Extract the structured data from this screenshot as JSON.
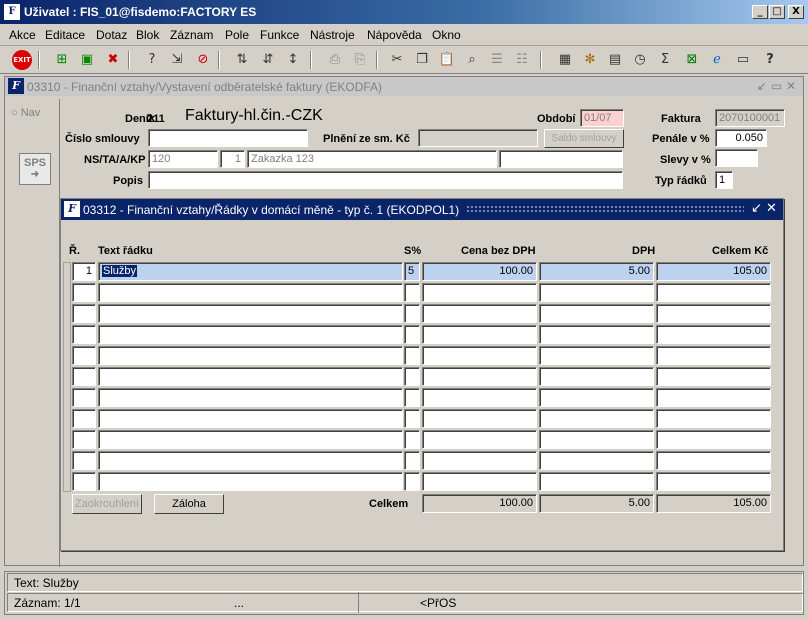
{
  "window": {
    "title": "Uživatel : FIS_01@fisdemo:FACTORY ES",
    "app_icon": "F",
    "minimize": "_",
    "maximize": "□",
    "close": "X"
  },
  "menu": [
    "Akce",
    "Editace",
    "Dotaz",
    "Blok",
    "Záznam",
    "Pole",
    "Funkce",
    "Nástroje",
    "Nápověda",
    "Okno"
  ],
  "toolbar": {
    "exit": "EXIT"
  },
  "form1": {
    "title": "03310 - Finanční vztahy/Vystavení odběratelské faktury (EKODFA)",
    "nav": "Nav",
    "sps": "SPS",
    "labels": {
      "denik": "Deník",
      "denik_val": "211",
      "denik_name": "Faktury-hl.čin.-CZK",
      "obdobi": "Období",
      "faktura": "Faktura",
      "cislo_smlouvy": "Číslo smlouvy",
      "plneni": "Plnění ze sm. Kč",
      "penale": "Penále v %",
      "nstaakp": "NS/TA/A/KP",
      "slevy": "Slevy v %",
      "popis": "Popis",
      "typ_radku": "Typ řádků"
    },
    "values": {
      "obdobi": "01/07",
      "faktura": "2070100001",
      "cislo_smlouvy": "",
      "plneni": "",
      "penale": "0.050",
      "ns": "120",
      "ta": "1",
      "zakazka": "Zakazka 123",
      "kp": "",
      "slevy": "",
      "popis": "",
      "typ_radku": "1"
    },
    "saldo_button": "Saldo smlouvy"
  },
  "form2": {
    "title": "03312 - Finanční vztahy/Řádky v domácí měně - typ č. 1 (EKODPOL1)",
    "columns": {
      "r": "Ř.",
      "text": "Text řádku",
      "s": "S%",
      "cena": "Cena bez DPH",
      "dph": "DPH",
      "celkem": "Celkem Kč"
    },
    "rows": [
      {
        "r": "1",
        "text": "Služby",
        "s": "5",
        "cena": "100.00",
        "dph": "5.00",
        "celkem": "105.00"
      }
    ],
    "empty_rows": 10,
    "zaokrouhleni": "Zaokrouhlení",
    "zaloha": "Záloha",
    "totals": {
      "label": "Celkem",
      "cena": "100.00",
      "dph": "5.00",
      "celkem": "105.00"
    }
  },
  "status": {
    "text": "Text: Služby",
    "record": "Záznam: 1/1",
    "mid": "...",
    "mode": "<PřOS"
  }
}
